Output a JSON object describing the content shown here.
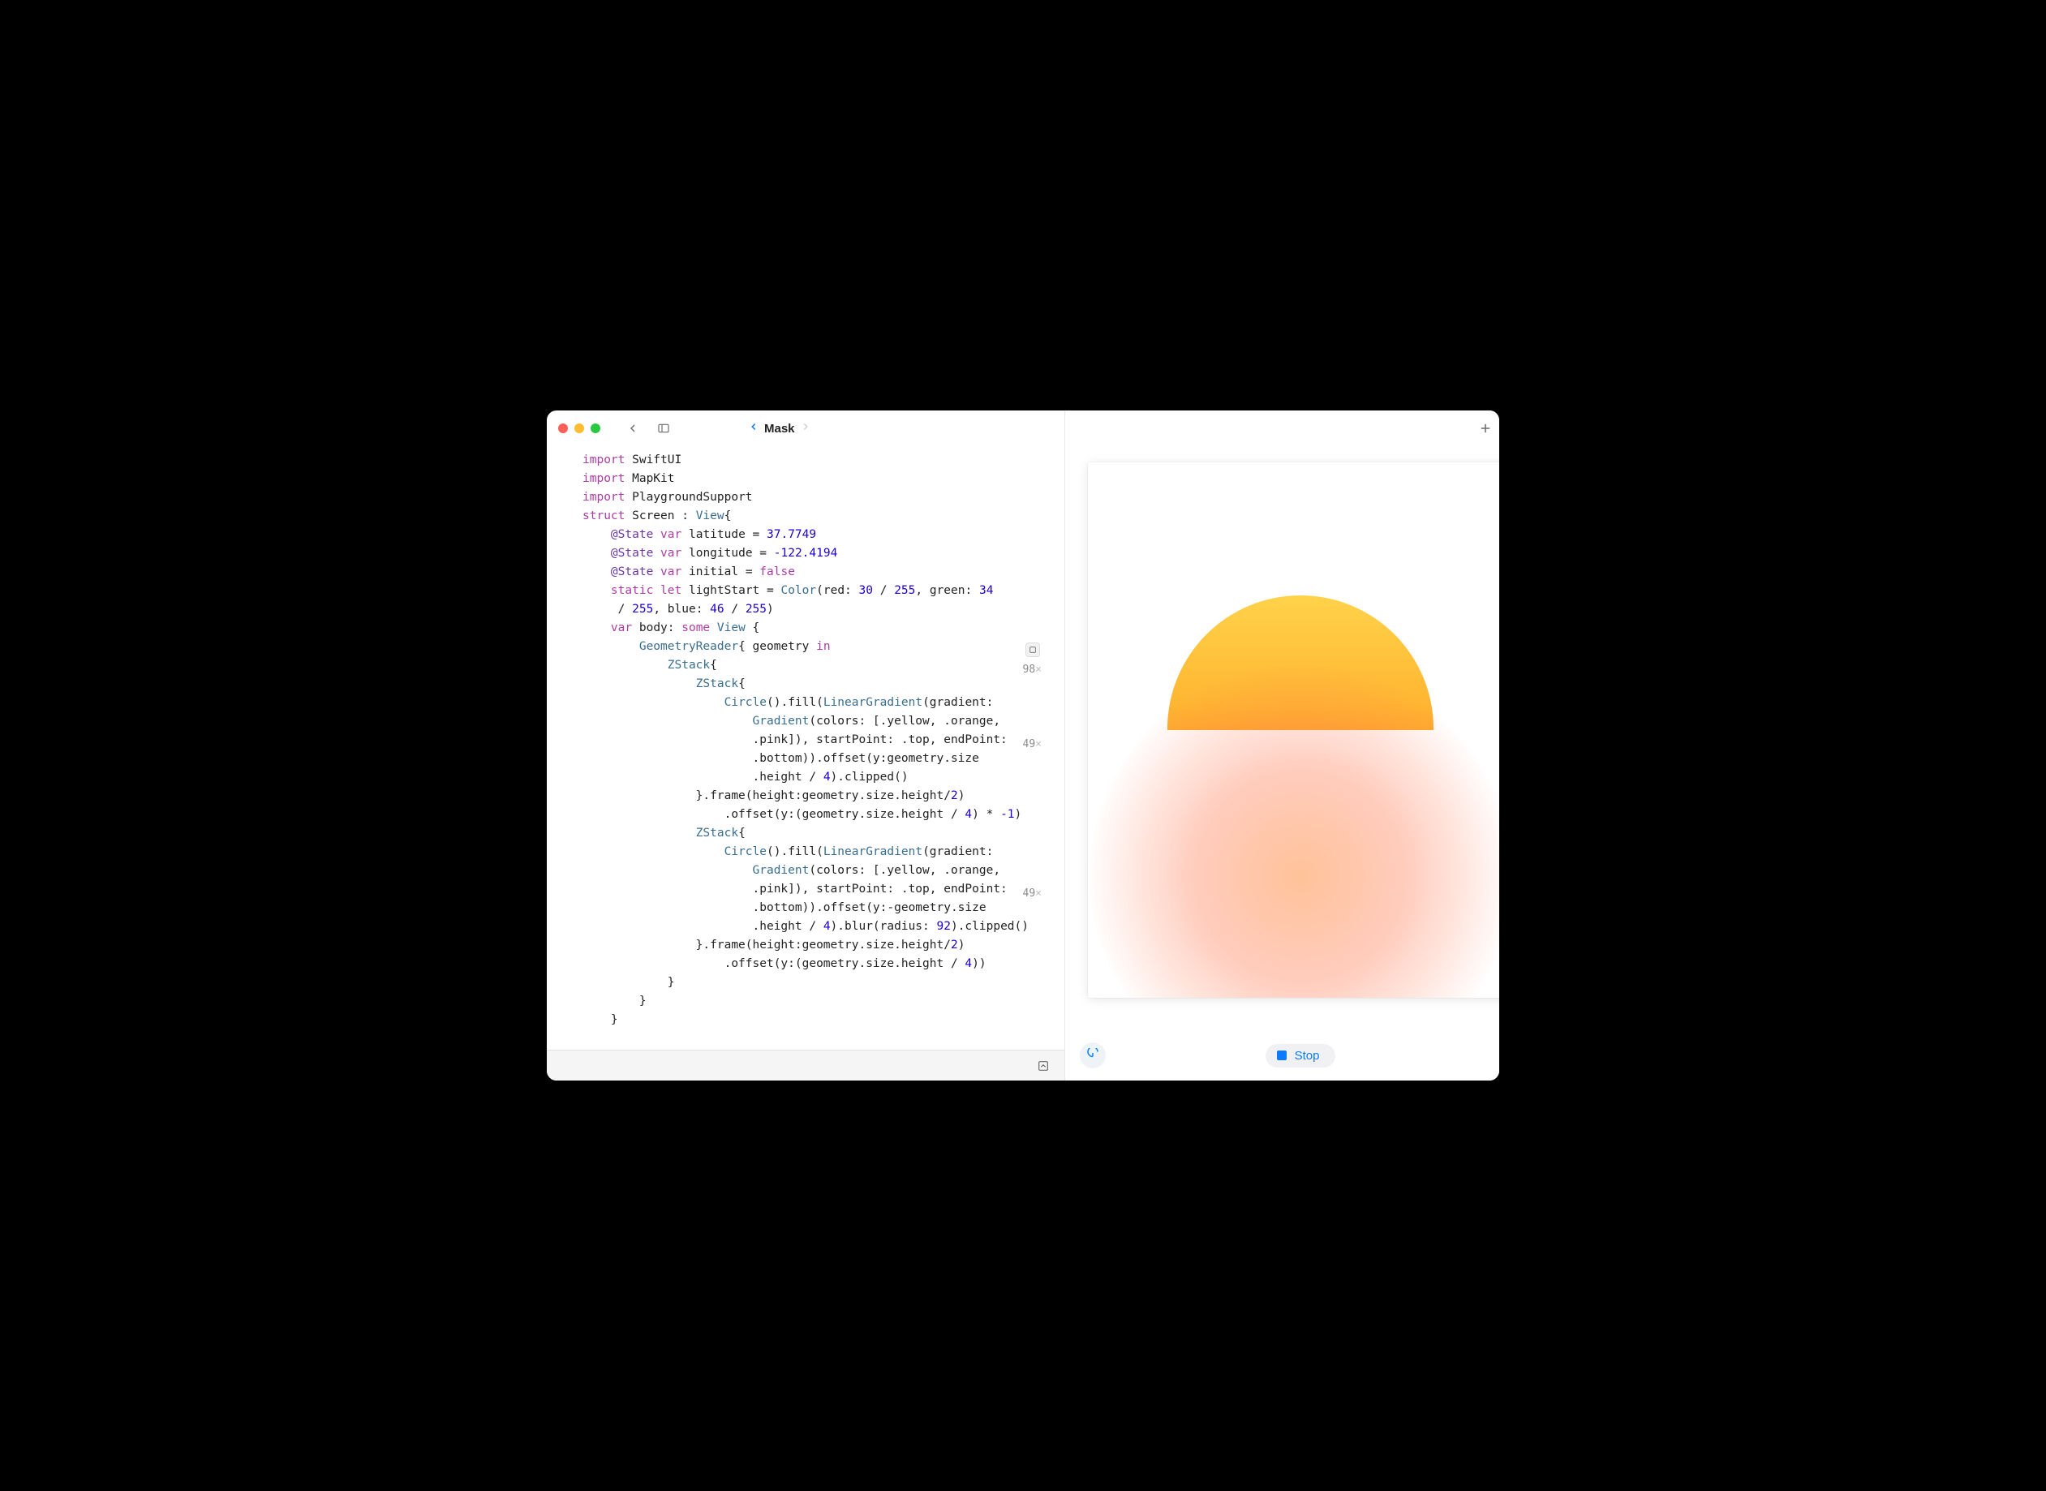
{
  "header": {
    "title": "Mask"
  },
  "runCounts": {
    "geometryReader": "98",
    "zstackA": "49",
    "zstackB": "49"
  },
  "code": {
    "lines": [
      {
        "indent": 0,
        "tokens": [
          {
            "t": "import",
            "c": "kw"
          },
          {
            "t": " SwiftUI"
          }
        ]
      },
      {
        "indent": 0,
        "tokens": [
          {
            "t": "import",
            "c": "kw"
          },
          {
            "t": " MapKit"
          }
        ]
      },
      {
        "indent": 0,
        "tokens": [
          {
            "t": "import",
            "c": "kw"
          },
          {
            "t": " PlaygroundSupport"
          }
        ]
      },
      {
        "indent": 0,
        "tokens": [
          {
            "t": "struct",
            "c": "kw"
          },
          {
            "t": " Screen : "
          },
          {
            "t": "View",
            "c": "type"
          },
          {
            "t": "{"
          }
        ]
      },
      {
        "indent": 1,
        "tokens": [
          {
            "t": "@State",
            "c": "attr"
          },
          {
            "t": " "
          },
          {
            "t": "var",
            "c": "kw"
          },
          {
            "t": " latitude = "
          },
          {
            "t": "37.7749",
            "c": "num"
          }
        ]
      },
      {
        "indent": 1,
        "tokens": [
          {
            "t": "@State",
            "c": "attr"
          },
          {
            "t": " "
          },
          {
            "t": "var",
            "c": "kw"
          },
          {
            "t": " longitude = "
          },
          {
            "t": "-122.4194",
            "c": "num"
          }
        ]
      },
      {
        "indent": 1,
        "tokens": [
          {
            "t": "@State",
            "c": "attr"
          },
          {
            "t": " "
          },
          {
            "t": "var",
            "c": "kw"
          },
          {
            "t": " initial = "
          },
          {
            "t": "false",
            "c": "kw"
          }
        ]
      },
      {
        "indent": 1,
        "tokens": [
          {
            "t": "static",
            "c": "kw"
          },
          {
            "t": " "
          },
          {
            "t": "let",
            "c": "kw"
          },
          {
            "t": " lightStart = "
          },
          {
            "t": "Color",
            "c": "type"
          },
          {
            "t": "(red: "
          },
          {
            "t": "30",
            "c": "num"
          },
          {
            "t": " / "
          },
          {
            "t": "255",
            "c": "num"
          },
          {
            "t": ", green: "
          },
          {
            "t": "34",
            "c": "num"
          }
        ]
      },
      {
        "indent": 1,
        "tokens": [
          {
            "t": " / "
          },
          {
            "t": "255",
            "c": "num"
          },
          {
            "t": ", blue: "
          },
          {
            "t": "46",
            "c": "num"
          },
          {
            "t": " / "
          },
          {
            "t": "255",
            "c": "num"
          },
          {
            "t": ")"
          }
        ]
      },
      {
        "indent": 1,
        "tokens": [
          {
            "t": "var",
            "c": "kw"
          },
          {
            "t": " body: "
          },
          {
            "t": "some",
            "c": "kw"
          },
          {
            "t": " "
          },
          {
            "t": "View",
            "c": "type"
          },
          {
            "t": " {"
          }
        ]
      },
      {
        "indent": 2,
        "tokens": [
          {
            "t": "GeometryReader",
            "c": "type"
          },
          {
            "t": "{ geometry "
          },
          {
            "t": "in",
            "c": "kw"
          }
        ]
      },
      {
        "indent": 3,
        "tokens": [
          {
            "t": "ZStack",
            "c": "type"
          },
          {
            "t": "{"
          }
        ]
      },
      {
        "indent": 4,
        "tokens": [
          {
            "t": "ZStack",
            "c": "type"
          },
          {
            "t": "{"
          }
        ]
      },
      {
        "indent": 5,
        "tokens": [
          {
            "t": "Circle",
            "c": "type"
          },
          {
            "t": "().fill("
          },
          {
            "t": "LinearGradient",
            "c": "type"
          },
          {
            "t": "(gradient:"
          }
        ]
      },
      {
        "indent": 6,
        "tokens": [
          {
            "t": "Gradient",
            "c": "type"
          },
          {
            "t": "(colors: [.yellow, .orange,"
          }
        ]
      },
      {
        "indent": 6,
        "tokens": [
          {
            "t": ".pink]), startPoint: .top, endPoint:"
          }
        ]
      },
      {
        "indent": 6,
        "tokens": [
          {
            "t": ".bottom)).offset(y:geometry.size"
          }
        ]
      },
      {
        "indent": 6,
        "tokens": [
          {
            "t": ".height / "
          },
          {
            "t": "4",
            "c": "num"
          },
          {
            "t": ").clipped()"
          }
        ]
      },
      {
        "indent": 4,
        "tokens": [
          {
            "t": "}.frame(height:geometry.size.height/"
          },
          {
            "t": "2",
            "c": "num"
          },
          {
            "t": ")"
          }
        ]
      },
      {
        "indent": 5,
        "tokens": [
          {
            "t": ".offset(y:(geometry.size.height / "
          },
          {
            "t": "4",
            "c": "num"
          },
          {
            "t": ") * "
          },
          {
            "t": "-1",
            "c": "num"
          },
          {
            "t": ")"
          }
        ]
      },
      {
        "indent": 4,
        "tokens": [
          {
            "t": "ZStack",
            "c": "type"
          },
          {
            "t": "{"
          }
        ]
      },
      {
        "indent": 5,
        "tokens": [
          {
            "t": "Circle",
            "c": "type"
          },
          {
            "t": "().fill("
          },
          {
            "t": "LinearGradient",
            "c": "type"
          },
          {
            "t": "(gradient:"
          }
        ]
      },
      {
        "indent": 6,
        "tokens": [
          {
            "t": "Gradient",
            "c": "type"
          },
          {
            "t": "(colors: [.yellow, .orange,"
          }
        ]
      },
      {
        "indent": 6,
        "tokens": [
          {
            "t": ".pink]), startPoint: .top, endPoint:"
          }
        ]
      },
      {
        "indent": 6,
        "tokens": [
          {
            "t": ".bottom)).offset(y:-geometry.size"
          }
        ]
      },
      {
        "indent": 6,
        "tokens": [
          {
            "t": ".height / "
          },
          {
            "t": "4",
            "c": "num"
          },
          {
            "t": ").blur(radius: "
          },
          {
            "t": "92",
            "c": "num"
          },
          {
            "t": ").clipped()"
          }
        ]
      },
      {
        "indent": 4,
        "tokens": [
          {
            "t": "}.frame(height:geometry.size.height/"
          },
          {
            "t": "2",
            "c": "num"
          },
          {
            "t": ")"
          }
        ]
      },
      {
        "indent": 5,
        "tokens": [
          {
            "t": ".offset(y:(geometry.size.height / "
          },
          {
            "t": "4",
            "c": "num"
          },
          {
            "t": "))"
          }
        ]
      },
      {
        "indent": 3,
        "tokens": [
          {
            "t": "}"
          }
        ]
      },
      {
        "indent": 2,
        "tokens": [
          {
            "t": "}"
          }
        ]
      },
      {
        "indent": 1,
        "tokens": [
          {
            "t": "}"
          }
        ]
      }
    ]
  },
  "runbar": {
    "stop_label": "Stop"
  }
}
